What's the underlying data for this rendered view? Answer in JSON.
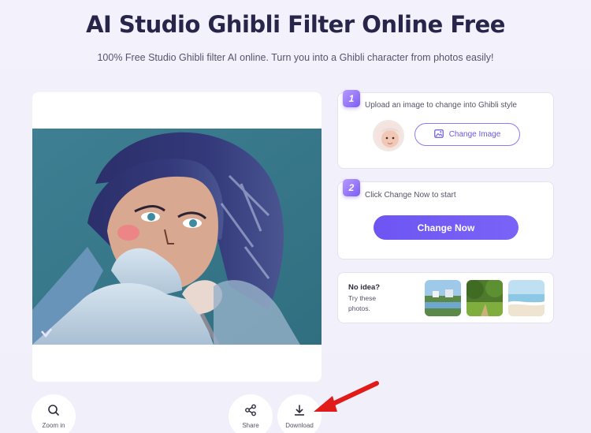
{
  "header": {
    "title": "AI Studio Ghibli Filter Online Free",
    "subtitle": "100% Free Studio Ghibli filter AI online. Turn you into a Ghibli character from photos easily!"
  },
  "step1": {
    "number": "1",
    "instruction": "Upload an image to change into Ghibli style",
    "change_image_label": "Change Image"
  },
  "step2": {
    "number": "2",
    "instruction": "Click Change Now to start",
    "change_now_label": "Change Now"
  },
  "ideas": {
    "title": "No idea?",
    "subtitle": "Try these photos."
  },
  "toolbar": {
    "zoom_label": "Zoom in",
    "share_label": "Share",
    "download_label": "Download"
  },
  "colors": {
    "accent": "#7056f4",
    "title": "#27254a",
    "annotation_arrow": "#e11a1a"
  }
}
